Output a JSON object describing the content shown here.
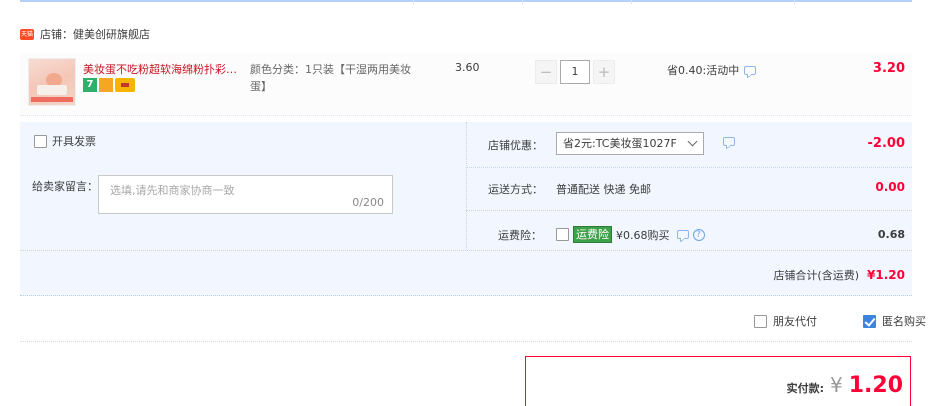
{
  "shop": {
    "badge": "天猫",
    "label": "店铺：健美创研旗舰店"
  },
  "item": {
    "title": "美妆蛋不吃粉超软海绵粉扑彩妆...",
    "badge_seven": "7",
    "spec": "颜色分类：1只装【干湿两用美妆蛋】",
    "price": "3.60",
    "qty_minus": "−",
    "qty_value": "1",
    "qty_plus": "+",
    "discount": "省0.40:活动中",
    "subtotal": "3.20"
  },
  "order": {
    "invoice_label": "开具发票",
    "memo_label": "给卖家留言：",
    "memo_placeholder": "选填,请先和商家协商一致",
    "memo_count": "0/200",
    "coupon_label": "店铺优惠：",
    "coupon_value": "省2元:TC美妆蛋1027F",
    "coupon_amount": "-2.00",
    "ship_label": "运送方式：",
    "ship_value": "普通配送 快递 免邮",
    "ship_amount": "0.00",
    "insurance_label": "运费险：",
    "insurance_badge": "运费险",
    "insurance_text": "¥0.68购买",
    "insurance_help": "?",
    "insurance_amount": "0.68",
    "shop_total_label": "店铺合计(含运费)",
    "shop_total_value": "¥1.20"
  },
  "options": {
    "friend_pay": "朋友代付",
    "anonymous": "匿名购买"
  },
  "pay": {
    "label": "实付款:",
    "currency": "¥",
    "amount": "1.20"
  },
  "colors": {
    "accent_red": "#ff0036",
    "panel_bg": "#f2f7ff",
    "checkbox_blue": "#3d83e0"
  }
}
